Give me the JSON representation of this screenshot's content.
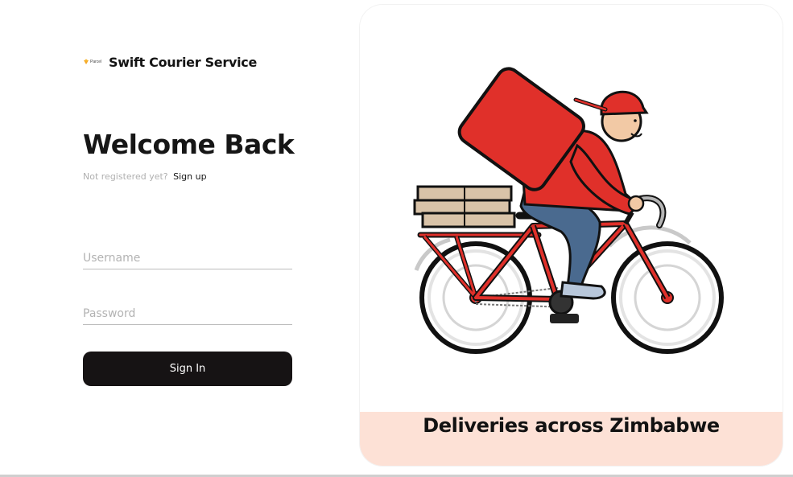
{
  "brand": {
    "logo_word": "Parcel",
    "name": "Swift Courier Service"
  },
  "login": {
    "heading": "Welcome Back",
    "register_prompt": "Not registered yet?",
    "signup_link": "Sign up",
    "username_placeholder": "Username",
    "password_placeholder": "Password",
    "signin_label": "Sign In"
  },
  "hero": {
    "caption": "Deliveries across Zimbabwe",
    "illustration_icon": "courier-cyclist-icon"
  },
  "colors": {
    "accent_dark": "#161314",
    "caption_band": "#fde1d6",
    "courier_red": "#e0302a",
    "brand_orange": "#f5a623"
  }
}
